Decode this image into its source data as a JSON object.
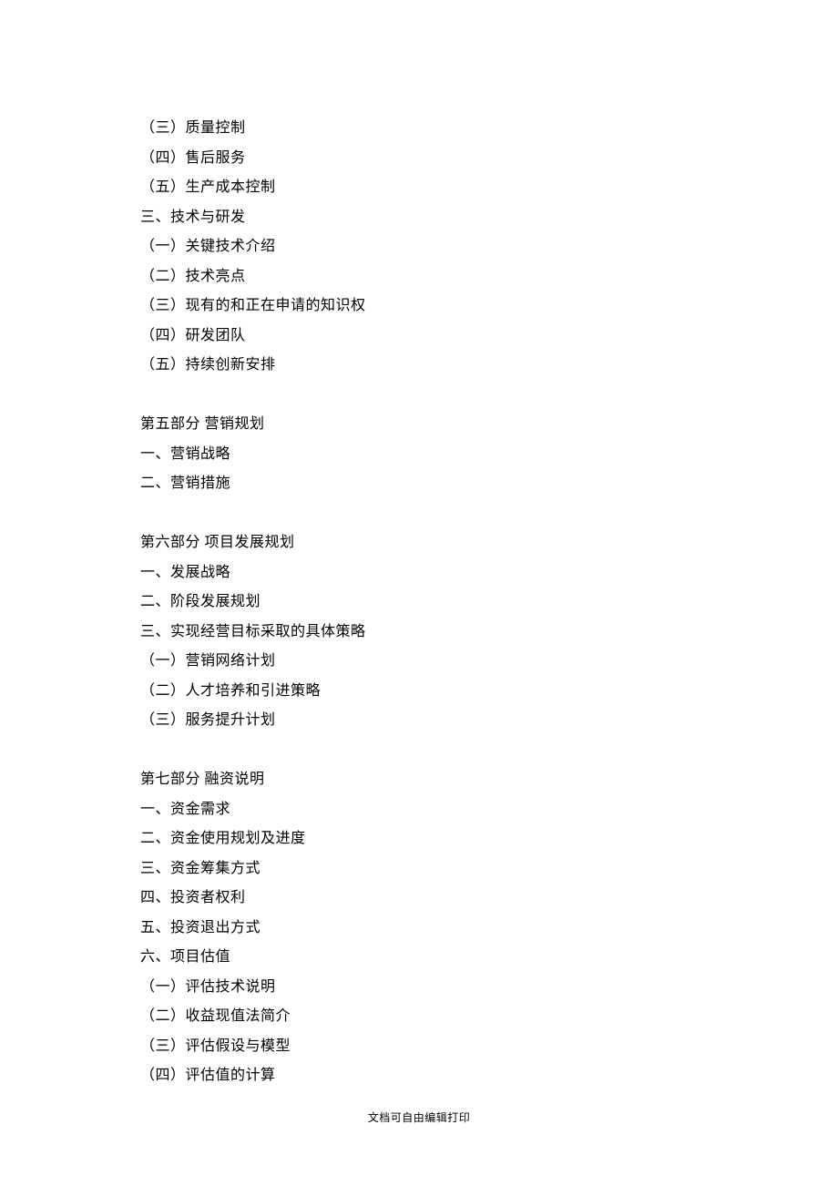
{
  "group1": [
    "（三）质量控制",
    "（四）售后服务",
    "（五）生产成本控制",
    "三、技术与研发",
    "（一）关键技术介绍",
    "（二）技术亮点",
    "（三）现有的和正在申请的知识权",
    "（四）研发团队",
    "（五）持续创新安排"
  ],
  "group2": [
    "第五部分  营销规划",
    "一、营销战略",
    "二、营销措施"
  ],
  "group3": [
    "第六部分  项目发展规划",
    "一、发展战略",
    "二、阶段发展规划",
    "三、实现经营目标采取的具体策略",
    "（一）营销网络计划",
    "（二）人才培养和引进策略",
    "（三）服务提升计划"
  ],
  "group4": [
    "第七部分  融资说明",
    "一、资金需求",
    "二、资金使用规划及进度",
    "三、资金筹集方式",
    "四、投资者权利",
    "五、投资退出方式",
    "六、项目估值",
    "（一）评估技术说明",
    "（二）收益现值法简介",
    "（三）评估假设与模型",
    "（四）评估值的计算"
  ],
  "footer": "文档可自由编辑打印"
}
